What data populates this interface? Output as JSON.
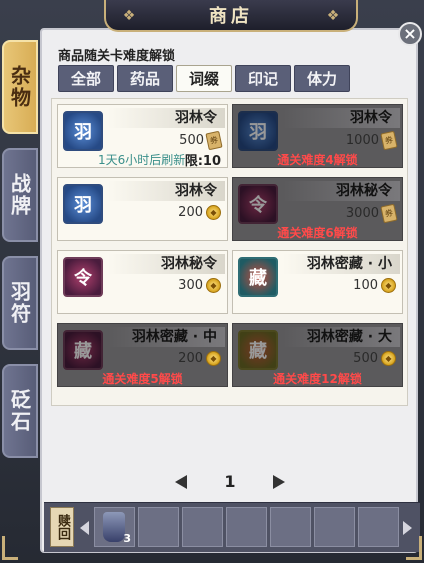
{
  "header": {
    "title": "商店"
  },
  "hint": "商品随关卡难度解锁",
  "side_tabs": [
    {
      "label": "杂物",
      "active": true
    },
    {
      "label": "战牌",
      "active": false
    },
    {
      "label": "羽符",
      "active": false
    },
    {
      "label": "砭石",
      "active": false
    }
  ],
  "top_tabs": [
    {
      "label": "全部",
      "active": false
    },
    {
      "label": "药品",
      "active": false
    },
    {
      "label": "词缀",
      "active": true
    },
    {
      "label": "印记",
      "active": false
    },
    {
      "label": "体力",
      "active": false
    }
  ],
  "items": [
    {
      "name": "羽林令",
      "price": "500",
      "currency": "ticket",
      "refresh": "1天6小时后刷新",
      "limit": "限:10",
      "locked": false,
      "icon": "blue"
    },
    {
      "name": "羽林令",
      "price": "1000",
      "currency": "ticket",
      "lock_text": "通关难度4解锁",
      "locked": true,
      "icon": "blue"
    },
    {
      "name": "羽林令",
      "price": "200",
      "currency": "coin",
      "locked": false,
      "icon": "blue"
    },
    {
      "name": "羽林秘令",
      "price": "3000",
      "currency": "ticket",
      "lock_text": "通关难度6解锁",
      "locked": true,
      "icon": "purple"
    },
    {
      "name": "羽林秘令",
      "price": "300",
      "currency": "coin",
      "locked": false,
      "icon": "purple"
    },
    {
      "name": "羽林密藏 · 小",
      "price": "100",
      "currency": "coin",
      "locked": false,
      "icon": "teal"
    },
    {
      "name": "羽林密藏 · 中",
      "price": "200",
      "currency": "coin",
      "lock_text": "通关难度5解锁",
      "locked": true,
      "icon": "purple"
    },
    {
      "name": "羽林密藏 · 大",
      "price": "500",
      "currency": "coin",
      "lock_text": "通关难度12解锁",
      "locked": true,
      "icon": "gold"
    }
  ],
  "pager": {
    "page": "1"
  },
  "buyback": {
    "label": "赎回",
    "slot_count": "3"
  },
  "colors": {
    "accent_gold": "#c9b07a",
    "lock_red": "#ff4a4a",
    "refresh_teal": "#3a8f8a"
  },
  "icons": {
    "close": "close-icon",
    "coin": "coin-icon",
    "ticket": "ticket-icon"
  }
}
